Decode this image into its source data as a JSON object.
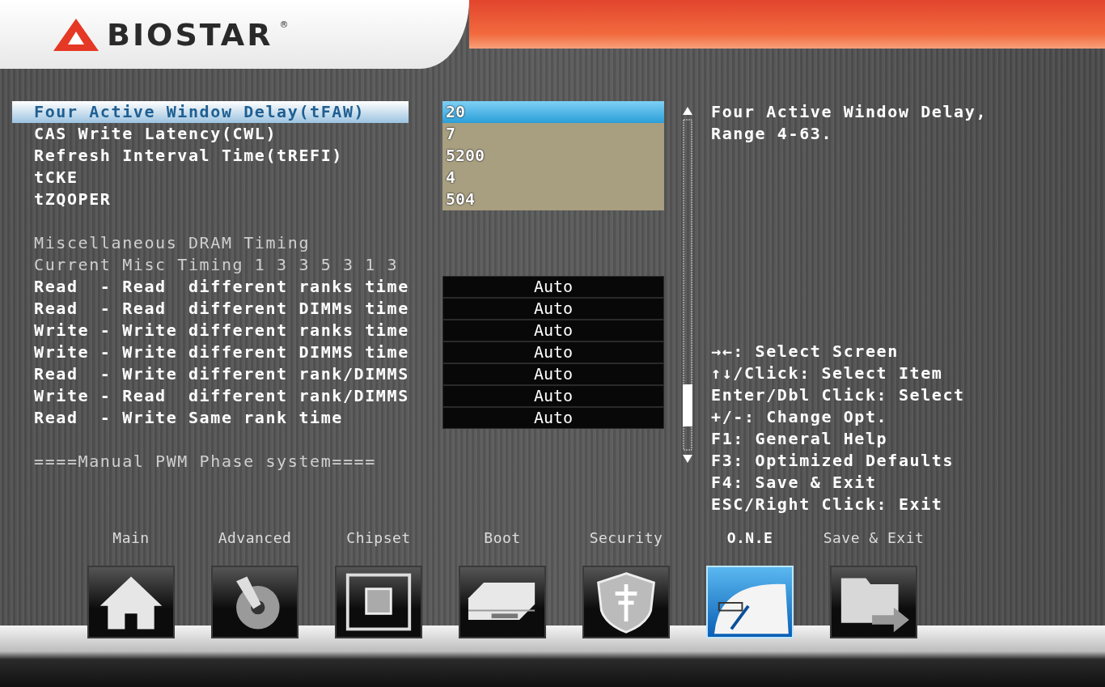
{
  "logo": {
    "name": "BIOSTAR",
    "mark": "®"
  },
  "groups": [
    {
      "items": [
        {
          "kind": "value",
          "label": "Four Active Window Delay(tFAW)",
          "value": "20",
          "selected": true
        },
        {
          "kind": "value",
          "label": "CAS Write Latency(CWL)",
          "value": "7",
          "selected": false
        },
        {
          "kind": "value",
          "label": "Refresh Interval Time(tREFI)",
          "value": "5200",
          "selected": false
        },
        {
          "kind": "value",
          "label": "tCKE",
          "value": "4",
          "selected": false
        },
        {
          "kind": "value",
          "label": "tZQOPER",
          "value": "504",
          "selected": false
        }
      ]
    },
    {
      "items": [
        {
          "kind": "info",
          "label": "Miscellaneous DRAM Timing"
        },
        {
          "kind": "info",
          "label": "Current Misc Timing 1 3 3 5 3 1 3"
        },
        {
          "kind": "select",
          "label": "Read  - Read  different ranks time",
          "value": "Auto",
          "selected": false
        },
        {
          "kind": "select",
          "label": "Read  - Read  different DIMMs time",
          "value": "Auto",
          "selected": false
        },
        {
          "kind": "select",
          "label": "Write - Write different ranks time",
          "value": "Auto",
          "selected": false
        },
        {
          "kind": "select",
          "label": "Write - Write different DIMMS time",
          "value": "Auto",
          "selected": false
        },
        {
          "kind": "select",
          "label": "Read  - Write different rank/DIMMS",
          "value": "Auto",
          "selected": false
        },
        {
          "kind": "select",
          "label": "Write - Read  different rank/DIMMS",
          "value": "Auto",
          "selected": false
        },
        {
          "kind": "select",
          "label": "Read  - Write Same rank time",
          "value": "Auto",
          "selected": false
        }
      ]
    },
    {
      "items": [
        {
          "kind": "title",
          "label": "====Manual PWM Phase system===="
        }
      ]
    }
  ],
  "help": {
    "description": [
      "Four Active Window Delay,",
      "Range 4-63."
    ],
    "keys": [
      "→←: Select Screen",
      "↑↓/Click: Select Item",
      "Enter/Dbl Click: Select",
      "+/-: Change Opt.",
      "F1: General Help",
      "F3: Optimized Defaults",
      "F4: Save & Exit",
      "ESC/Right Click: Exit"
    ]
  },
  "tabs": [
    {
      "label": "Main",
      "selected": false
    },
    {
      "label": "Advanced",
      "selected": false
    },
    {
      "label": "Chipset",
      "selected": false
    },
    {
      "label": "Boot",
      "selected": false
    },
    {
      "label": "Security",
      "selected": false
    },
    {
      "label": "O.N.E",
      "selected": true
    },
    {
      "label": "Save & Exit",
      "selected": false
    }
  ]
}
